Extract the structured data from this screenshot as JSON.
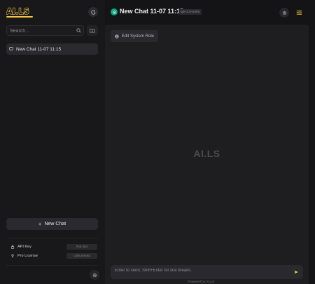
{
  "app": {
    "logo_text": "AI.LS",
    "brand_color": "#f6c744"
  },
  "sidebar": {
    "search_placeholder": "Search...",
    "chats": [
      {
        "title": "New Chat 11-07 11:15",
        "icon": "chat-bubble-icon"
      }
    ],
    "new_chat_label": "New Chat",
    "api_key_label": "API Key",
    "api_key_value": "Not Set",
    "pro_license_label": "Pro License",
    "pro_license_value": "Unlicensed"
  },
  "header": {
    "title": "New Chat 11-07 11:15",
    "model": "gpt-3.5-turbo",
    "model_icon_color": "#0fa37f"
  },
  "main": {
    "edit_system_role_label": "Edit System Role",
    "watermark": "AI.LS",
    "input_placeholder": "Enter to send. Shift+Enter for line breaks.",
    "footer_partial": "Powered by AI.LS"
  }
}
